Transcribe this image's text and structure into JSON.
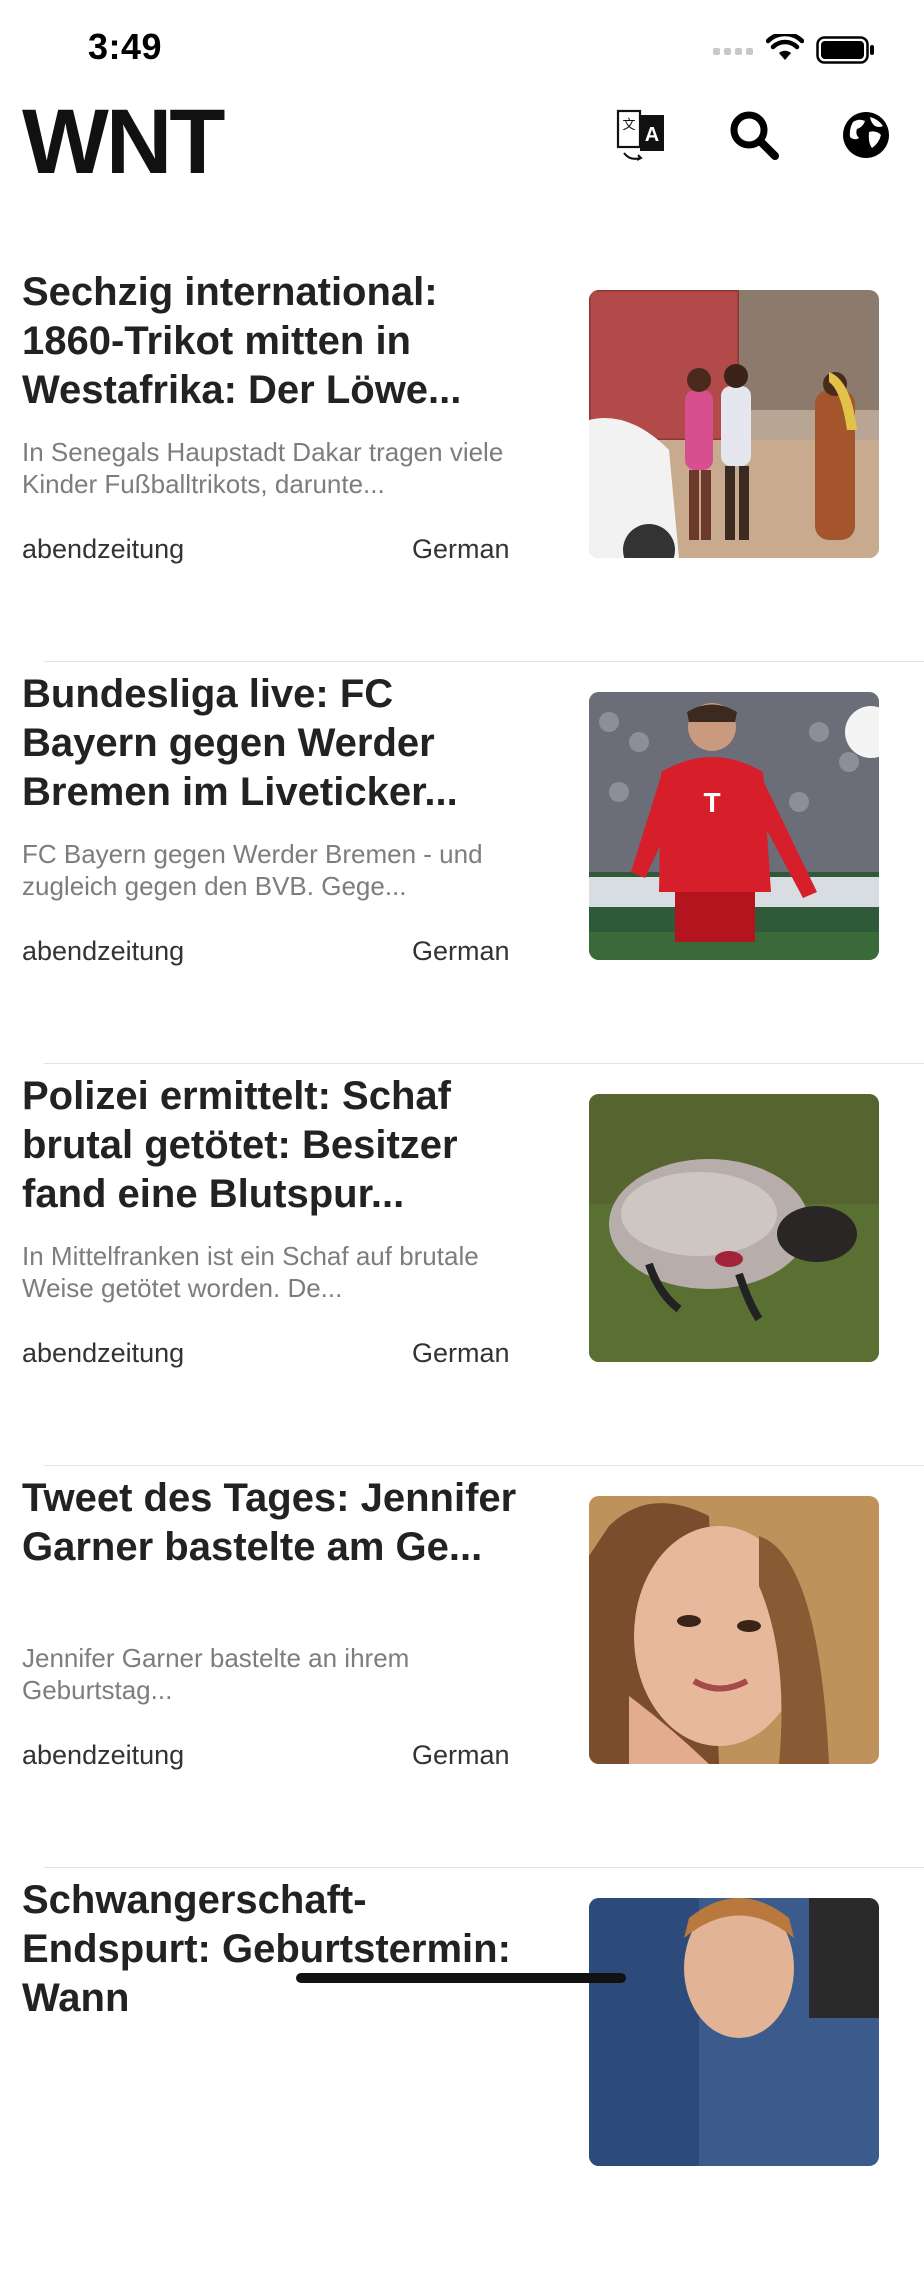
{
  "status_bar": {
    "time": "3:49"
  },
  "header": {
    "logo": "WNT",
    "icons": [
      "translate-icon",
      "search-icon",
      "globe-icon"
    ]
  },
  "articles": [
    {
      "title": "Sechzig international: 1860-Trikot mitten in Westafrika: Der Löwe...",
      "summary": "In Senegals Haupstadt Dakar tragen viele Kinder Fußballtrikots, darunte...",
      "source": "abendzeitung",
      "language": "German"
    },
    {
      "title": "Bundesliga live: FC Bayern gegen Werder Bremen im Liveticker...",
      "summary": "FC Bayern gegen Werder Bremen - und zugleich gegen den BVB. Gege...",
      "source": "abendzeitung",
      "language": "German"
    },
    {
      "title": "Polizei ermittelt: Schaf brutal getötet: Besitzer fand eine Blutspur...",
      "summary": "In Mittelfranken ist ein Schaf auf brutale Weise getötet worden. De...",
      "source": "abendzeitung",
      "language": "German"
    },
    {
      "title": "Tweet des Tages: Jennifer Garner bastelte am Ge...",
      "summary": "Jennifer Garner bastelte an ihrem Geburtstag...",
      "source": "abendzeitung",
      "language": "German"
    },
    {
      "title": "Schwangerschaft-Endspurt: Geburtstermin: Wann",
      "summary": "",
      "source": "",
      "language": ""
    }
  ],
  "colors": {
    "text": "#222222",
    "muted": "#7d7d7d",
    "divider": "#e3e3e3"
  }
}
